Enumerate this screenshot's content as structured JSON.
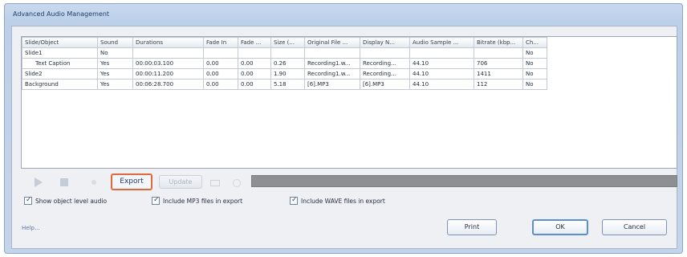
{
  "window": {
    "title": "Advanced Audio Management"
  },
  "table": {
    "headers": [
      "Slide/Object",
      "Sound",
      "Durations",
      "Fade In",
      "Fade ...",
      "Size (...",
      "Original File ...",
      "Display N...",
      "Audio Sample ...",
      "Bitrate (kbp...",
      "Ch..."
    ],
    "rows": [
      [
        "Slide1",
        "No",
        "",
        "",
        "",
        "",
        "",
        "",
        "",
        "",
        "No"
      ],
      [
        "Text Caption",
        "Yes",
        "00:00:03.100",
        "0.00",
        "0.00",
        "0.26",
        "Recording1.w...",
        "Recording...",
        "44.10",
        "706",
        "No"
      ],
      [
        "Slide2",
        "Yes",
        "00:00:11.200",
        "0.00",
        "0.00",
        "1.90",
        "Recording1.w...",
        "Recording...",
        "44.10",
        "1411",
        "No"
      ],
      [
        "Background",
        "Yes",
        "00:06:28.700",
        "0.00",
        "0.00",
        "5.18",
        "[6].MP3",
        "[6].MP3",
        "44.10",
        "112",
        "No"
      ]
    ]
  },
  "toolbar": {
    "play_icon": "play-icon",
    "stop_icon": "stop-icon",
    "record_icon": "record-icon",
    "export_label": "Export",
    "disabled_label": "Update"
  },
  "checkboxes": [
    {
      "label": "Show object level audio",
      "checked": true
    },
    {
      "label": "Include MP3 files in export",
      "checked": true
    },
    {
      "label": "Include WAVE files in export",
      "checked": true
    }
  ],
  "footer": {
    "help": "Help...",
    "print": "Print",
    "ok": "OK",
    "cancel": "Cancel"
  },
  "colors": {
    "export_outline": "#e0683f",
    "ok_border": "#5a90cf",
    "progress_bar": "#8d8f92"
  }
}
